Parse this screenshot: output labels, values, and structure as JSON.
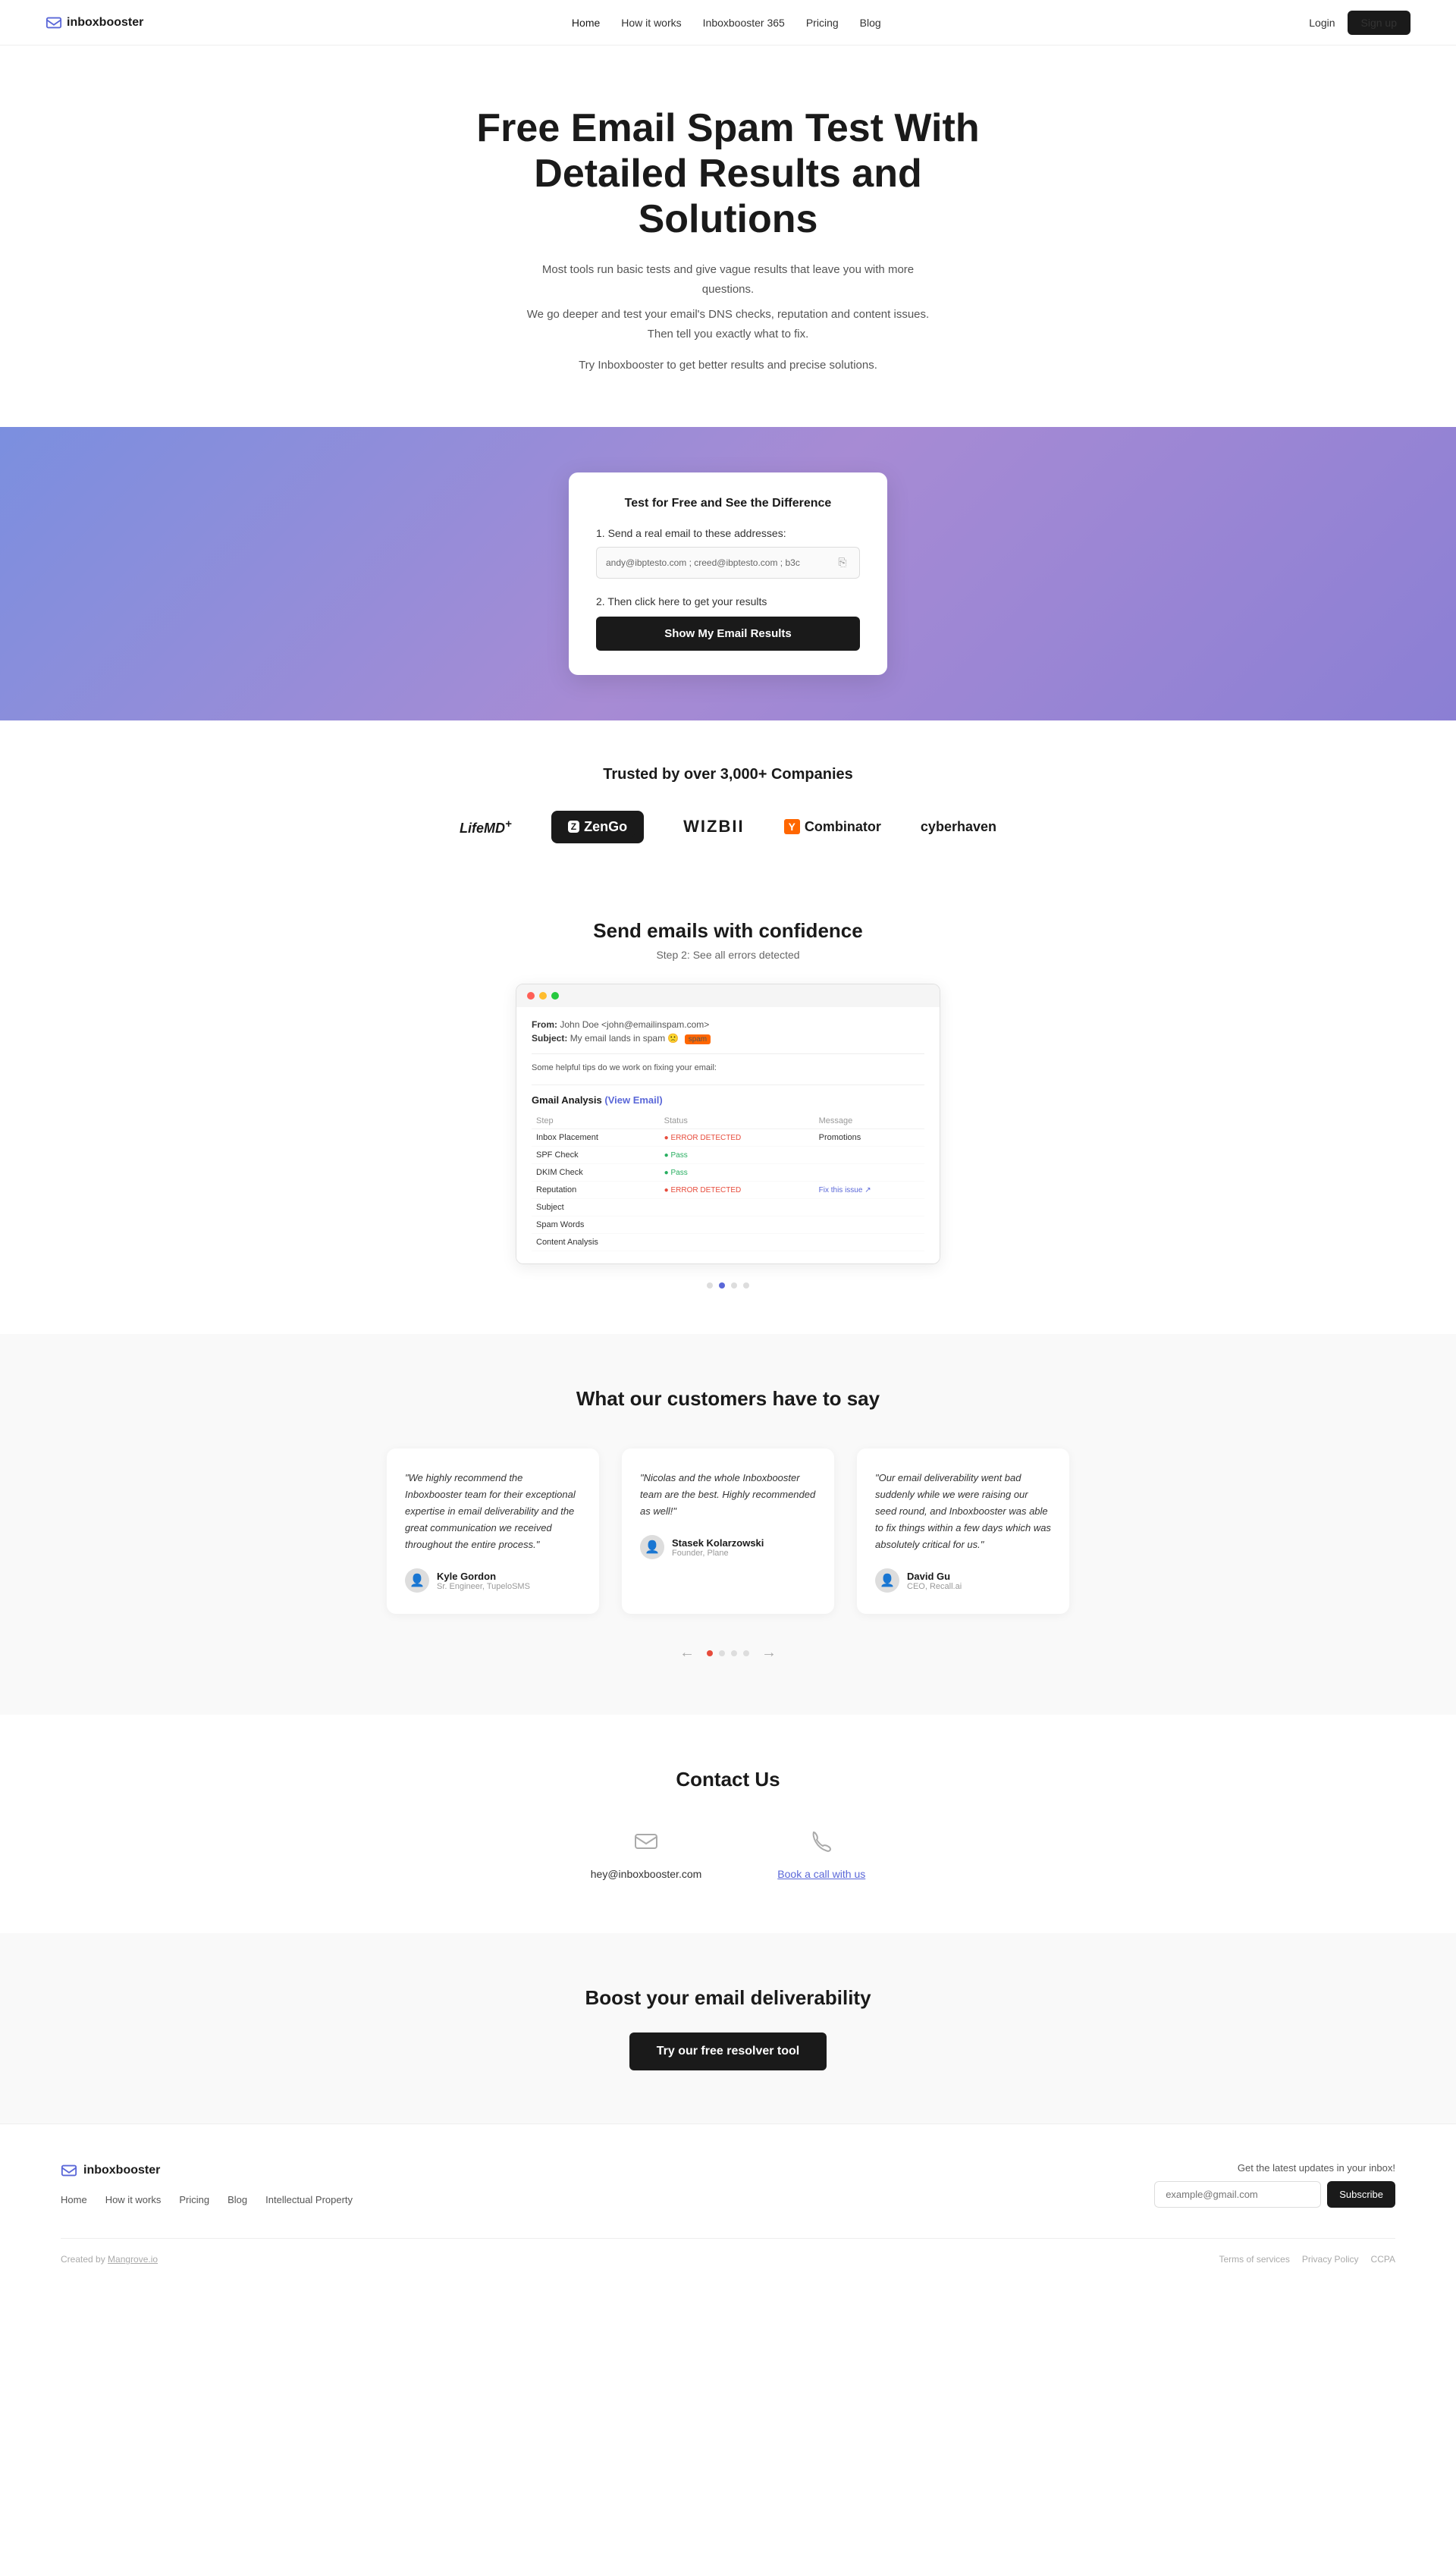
{
  "nav": {
    "logo_text": "inboxbooster",
    "links": [
      {
        "label": "Home",
        "active": true,
        "href": "#"
      },
      {
        "label": "How it works",
        "active": false,
        "href": "#"
      },
      {
        "label": "Inboxbooster 365",
        "active": false,
        "href": "#"
      },
      {
        "label": "Pricing",
        "active": false,
        "href": "#"
      },
      {
        "label": "Blog",
        "active": false,
        "href": "#"
      }
    ],
    "login": "Login",
    "signup": "Sign up"
  },
  "hero": {
    "title": "Free Email Spam Test With Detailed Results and Solutions",
    "description1": "Most tools run basic tests and give vague results that leave you with more questions.",
    "description2": "We go deeper and test your email's DNS checks, reputation and content issues. Then tell you exactly what to fix.",
    "cta": "Try Inboxbooster to get better results and precise solutions."
  },
  "test_card": {
    "title": "Test for Free and See the Difference",
    "step1_label": "1. Send a real email to these addresses:",
    "email_addresses": "andy@ibptesto.com ; creed@ibptesto.com ; b3c",
    "step2_label": "2. Then click here to get your results",
    "button_label": "Show My Email Results"
  },
  "trusted": {
    "title": "Trusted by over 3,000+ Companies",
    "logos": [
      "LifeMD+",
      "ZenGo",
      "WIZBII",
      "Y Combinator",
      "cyberhaven"
    ]
  },
  "send_emails": {
    "title": "Send emails with confidence",
    "subtitle": "Step 2: See all errors detected",
    "screenshot": {
      "from": "John Doe <john@emailinspam.com>",
      "subject": "My email lands in spam 🙁",
      "tips": "Some helpful tips do we work on fixing your email:",
      "gmail_analysis_title": "Gmail Analysis",
      "view_email_link": "(View Email)",
      "table_headers": [
        "Step",
        "Status",
        "Message"
      ],
      "rows": [
        {
          "step": "Inbox Placement",
          "status": "error_detected",
          "status_label": "ERROR DETECTED",
          "message": "Promotions",
          "fix_link": ""
        },
        {
          "step": "SPF Check",
          "status": "pass",
          "status_label": "Pass",
          "message": "",
          "fix_link": ""
        },
        {
          "step": "DKIM Check",
          "status": "pass",
          "status_label": "Pass",
          "message": "",
          "fix_link": ""
        },
        {
          "step": "Reputation",
          "status": "error_detected",
          "status_label": "ERROR DETECTED",
          "message": "",
          "fix_link": "Fix this issue ↗"
        },
        {
          "step": "Subject",
          "status": "",
          "status_label": "",
          "message": "",
          "fix_link": ""
        },
        {
          "step": "Spam Words",
          "status": "",
          "status_label": "",
          "message": "",
          "fix_link": ""
        },
        {
          "step": "Content Analysis",
          "status": "",
          "status_label": "",
          "message": "",
          "fix_link": ""
        }
      ]
    },
    "carousel_dots": [
      false,
      true,
      false,
      false
    ]
  },
  "testimonials": {
    "title": "What our customers have to say",
    "items": [
      {
        "text": "\"We highly recommend the Inboxbooster team for their exceptional expertise in email deliverability and the great communication we received throughout the entire process.\"",
        "name": "Kyle Gordon",
        "role": "Sr. Engineer, TupeloSMS"
      },
      {
        "text": "\"Nicolas and the whole Inboxbooster team are the best. Highly recommended as well!\"",
        "name": "Stasek Kolarzowski",
        "role": "Founder, Plane"
      },
      {
        "text": "\"Our email deliverability went bad suddenly while we were raising our seed round, and Inboxbooster was able to fix things within a few days which was absolutely critical for us.\"",
        "name": "David Gu",
        "role": "CEO, Recall.ai"
      }
    ],
    "nav_dots": [
      true,
      false,
      false,
      false
    ]
  },
  "contact": {
    "title": "Contact Us",
    "email": "hey@inboxbooster.com",
    "call_link": "Book a call with us"
  },
  "boost": {
    "title": "Boost your email deliverability",
    "button_label": "Try our free resolver tool"
  },
  "footer": {
    "logo_text": "inboxbooster",
    "links": [
      "Home",
      "How it works",
      "Pricing",
      "Blog",
      "Intellectual Property"
    ],
    "newsletter_label": "Get the latest updates in your inbox!",
    "newsletter_placeholder": "example@gmail.com",
    "subscribe_label": "Subscribe",
    "credit": "Created by Mangrove.io",
    "legal_links": [
      "Terms of services",
      "Privacy Policy",
      "CCPA"
    ]
  }
}
